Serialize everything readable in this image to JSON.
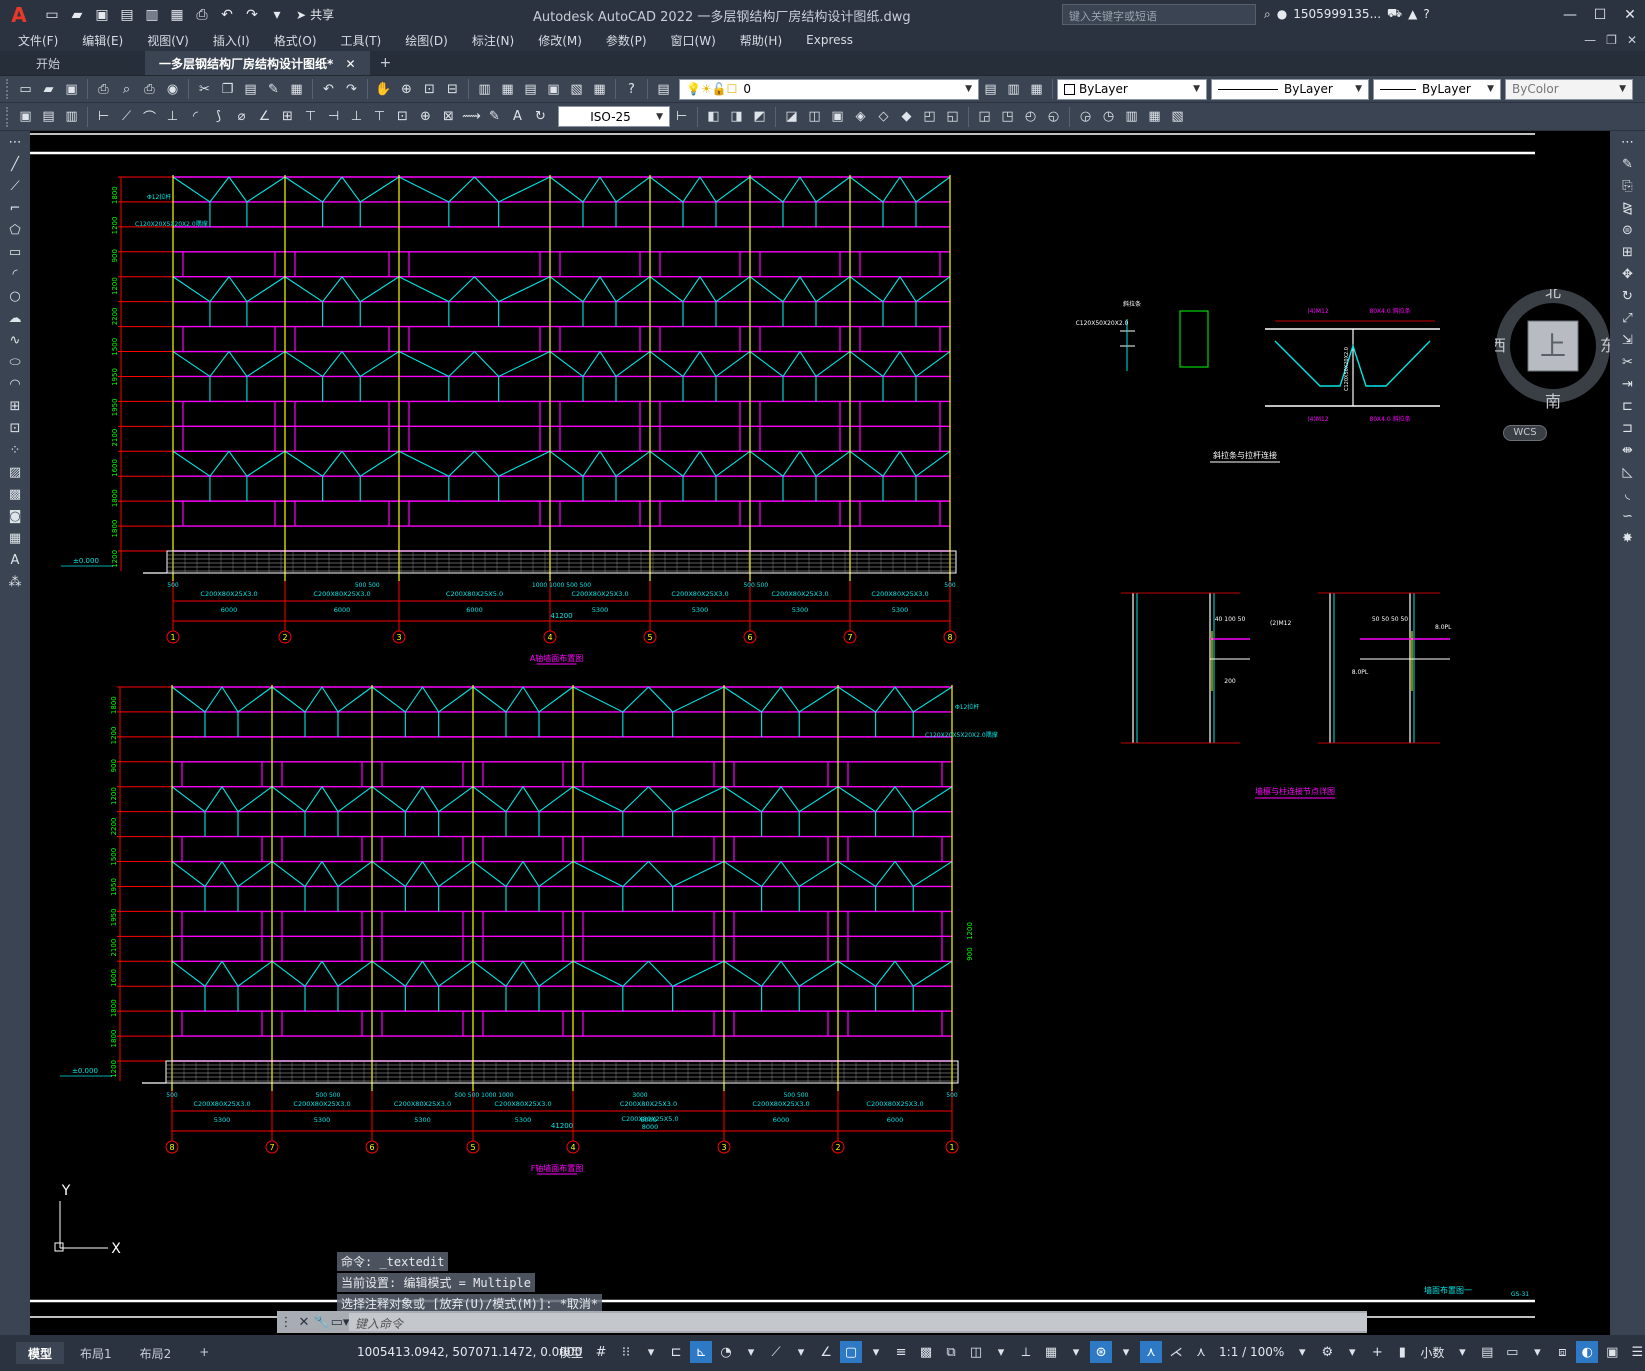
{
  "titlebar": {
    "app_logo": "A",
    "title": "Autodesk AutoCAD 2022    一多层钢结构厂房结构设计图纸.dwg",
    "share_label": "共享",
    "search_placeholder": "键入关键字或短语",
    "user_name": "1505999135..."
  },
  "menu": {
    "items": [
      "文件(F)",
      "编辑(E)",
      "视图(V)",
      "插入(I)",
      "格式(O)",
      "工具(T)",
      "绘图(D)",
      "标注(N)",
      "修改(M)",
      "参数(P)",
      "窗口(W)",
      "帮助(H)",
      "Express"
    ]
  },
  "tabs": {
    "start": "开始",
    "document": "一多层钢结构厂房结构设计图纸*",
    "close": "✕",
    "add": "+"
  },
  "toolbar1": {
    "layer_value": "0",
    "color_value": "ByLayer",
    "linetype_value": "ByLayer",
    "lineweight_value": "ByLayer",
    "plotstyle_value": "ByColor"
  },
  "toolbar2": {
    "dimstyle_value": "ISO-25"
  },
  "viewcube": {
    "north": "北",
    "south": "南",
    "east": "东",
    "west": "西",
    "face": "上",
    "wcs": "WCS"
  },
  "drawing": {
    "elev_a_title": "A轴墙面布置图",
    "elev_f_title": "F轴墙面布置图",
    "ground_label": "±0.000",
    "total_dim": "41200",
    "elev_a_axes": [
      "1",
      "2",
      "3",
      "4",
      "5",
      "6",
      "7",
      "8"
    ],
    "elev_f_axes": [
      "8",
      "7",
      "6",
      "5",
      "4",
      "3",
      "2",
      "1"
    ],
    "elev_a_spans": [
      "6000",
      "6000",
      "6000",
      "5300",
      "5300",
      "5300",
      "5300"
    ],
    "elev_f_spans": [
      "5300",
      "5300",
      "5300",
      "5300",
      "6000",
      "6000",
      "6000"
    ],
    "elev_a_purlin": "C200X80X25X3.0",
    "elev_a_purlin_alt": "C200X80X25X5.0",
    "elev_a_top_note1": "Φ12拉杆",
    "elev_a_top_note2": "C120X20X5X20X2.0隅撑",
    "elev_f_center_span": "8000",
    "elev_f_center_label": "C200X80X25X5.0",
    "elev_f_window_dims": [
      "900",
      "1200"
    ],
    "detail_brace_title": "斜拉条与拉杆连接",
    "detail_purlin_title": "墙檩与柱连接节点详图",
    "detail_labels": [
      "(4)M12",
      "80X4.0 斜拉条",
      "(2)M12",
      "8.0PL",
      "200",
      "40  100  50",
      "50 50 50 50",
      "拉杆",
      "斜拉条",
      "C120X50X20X2.0"
    ],
    "sheet_name": "墙面布置图一",
    "sheet_code": "GS-31",
    "side_dims": [
      "1800",
      "1200",
      "900",
      "1200",
      "2200",
      "1500",
      "1950",
      "1950",
      "2100",
      "1600",
      "1800",
      "1800",
      "1200"
    ],
    "bottom_small_dims_a": [
      "500",
      "500 500",
      "1000 1000 500 500",
      "500 500",
      "500"
    ],
    "bottom_small_dims_f": [
      "500",
      "500 500",
      "500 500 1000 1000",
      "3000",
      "500 500",
      "500"
    ]
  },
  "cmd": {
    "history": [
      "命令: _textedit",
      "当前设置: 编辑模式 = Multiple",
      "选择注释对象或 [放弃(U)/模式(M)]: *取消*"
    ],
    "placeholder": "键入命令"
  },
  "status": {
    "layout_tabs": [
      "模型",
      "布局1",
      "布局2"
    ],
    "add_layout": "+",
    "coordinates": "1005413.0942, 507071.1472, 0.0000",
    "model_label": "模型",
    "scale": "1:1 / 100%",
    "units": "小数"
  },
  "colors": {
    "magenta": "#ff00ff",
    "cyan": "#00e5e5",
    "yellow": "#ffff00",
    "red": "#ff0000",
    "green": "#00ff00",
    "white": "#ffffff"
  }
}
